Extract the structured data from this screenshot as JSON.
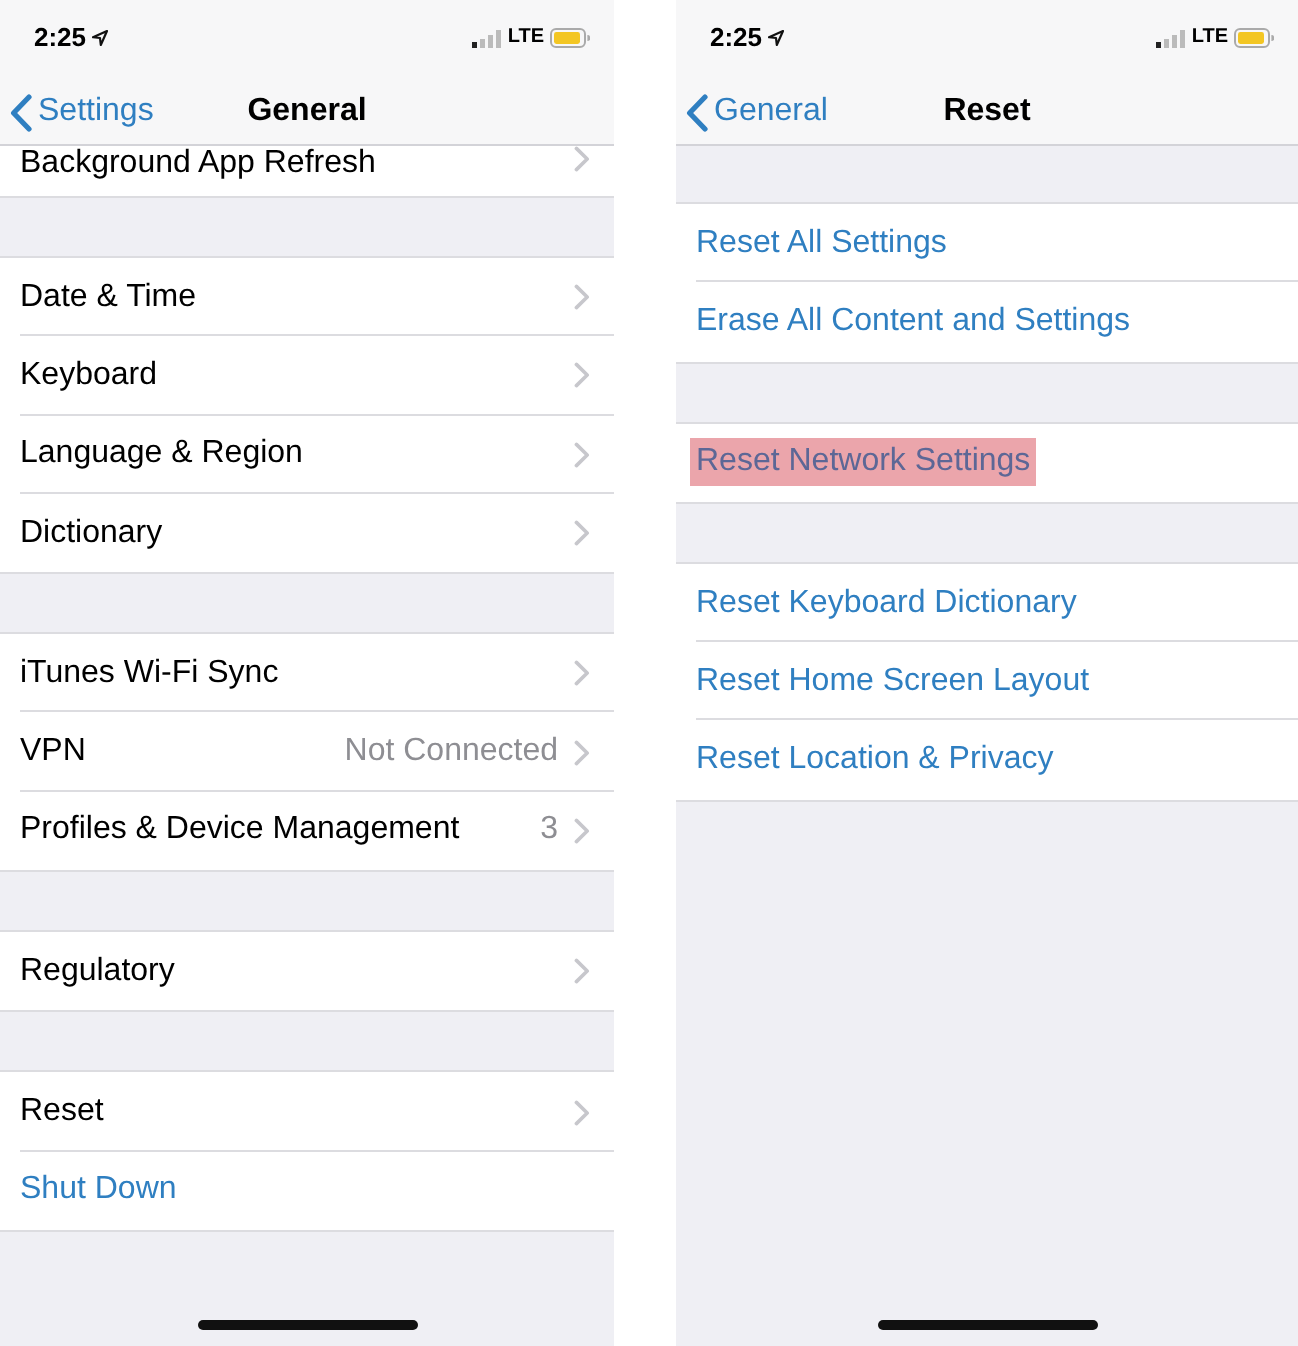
{
  "screens": [
    {
      "status_bar": {
        "time": "2:25",
        "network": "LTE"
      },
      "nav": {
        "back": "Settings",
        "title": "General"
      },
      "scrolled": true,
      "groups": [
        {
          "rows": [
            {
              "kind": "link",
              "label": "Background App Refresh"
            }
          ]
        },
        {
          "rows": [
            {
              "kind": "link",
              "label": "Date & Time"
            },
            {
              "kind": "link",
              "label": "Keyboard"
            },
            {
              "kind": "link",
              "label": "Language & Region"
            },
            {
              "kind": "link",
              "label": "Dictionary"
            }
          ]
        },
        {
          "rows": [
            {
              "kind": "link",
              "label": "iTunes Wi-Fi Sync"
            },
            {
              "kind": "link",
              "label": "VPN",
              "detail": "Not Connected"
            },
            {
              "kind": "link",
              "label": "Profiles & Device Management",
              "detail": "3"
            }
          ]
        },
        {
          "rows": [
            {
              "kind": "link",
              "label": "Regulatory"
            }
          ]
        },
        {
          "rows": [
            {
              "kind": "link",
              "label": "Reset"
            },
            {
              "kind": "action",
              "label": "Shut Down"
            }
          ]
        }
      ]
    },
    {
      "status_bar": {
        "time": "2:25",
        "network": "LTE"
      },
      "nav": {
        "back": "General",
        "title": "Reset"
      },
      "scrolled": false,
      "groups": [
        {
          "rows": [
            {
              "kind": "action",
              "label": "Reset All Settings",
              "highlighted": false
            },
            {
              "kind": "action",
              "label": "Erase All Content and Settings",
              "highlighted": false
            }
          ]
        },
        {
          "rows": [
            {
              "kind": "action",
              "label": "Reset Network Settings",
              "highlighted": true
            }
          ]
        },
        {
          "rows": [
            {
              "kind": "action",
              "label": "Reset Keyboard Dictionary",
              "highlighted": false
            },
            {
              "kind": "action",
              "label": "Reset Home Screen Layout",
              "highlighted": false
            },
            {
              "kind": "action",
              "label": "Reset Location & Privacy",
              "highlighted": false
            }
          ]
        }
      ]
    }
  ]
}
